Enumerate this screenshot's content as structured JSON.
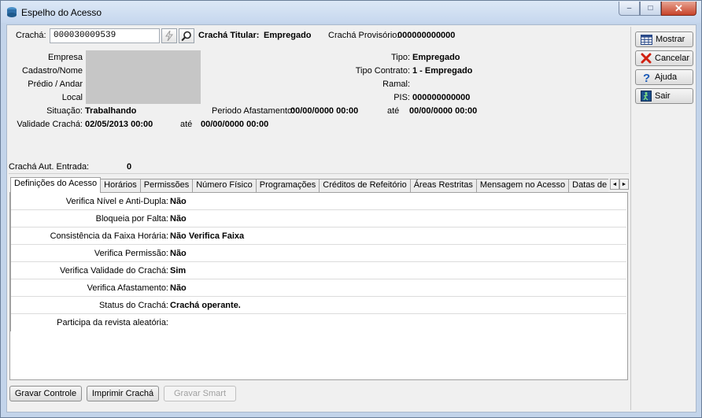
{
  "window": {
    "title": "Espelho do Acesso",
    "controls": {
      "minimize": "‒",
      "maximize": "□",
      "close": "✕"
    }
  },
  "header": {
    "cracha_label": "Crachá:",
    "cracha_value": "000030009539",
    "titular_label": "Crachá Titular:",
    "titular_value": "Empregado",
    "provisorio_label": "Crachá Provisório:",
    "provisorio_value": "000000000000"
  },
  "info_left": {
    "empresa_label": "Empresa",
    "cadastro_label": "Cadastro/Nome",
    "predio_label": "Prédio / Andar",
    "local_label": "Local",
    "situacao_label": "Situação:",
    "situacao_value": "Trabalhando",
    "validade_label": "Validade Crachá:",
    "validade_value": "02/05/2013 00:00",
    "ate_label": "até",
    "validade_ate_value": "00/00/0000 00:00",
    "aut_entrada_label": "Crachá Aut. Entrada:",
    "aut_entrada_value": "0"
  },
  "info_right": {
    "tipo_label": "Tipo:",
    "tipo_value": "Empregado",
    "tipo_contrato_label": "Tipo Contrato:",
    "tipo_contrato_value": "1 - Empregado",
    "ramal_label": "Ramal:",
    "pis_label": "PIS:",
    "pis_value": "000000000000",
    "periodo_label": "Periodo Afastamento:",
    "periodo_value": "00/00/0000 00:00",
    "periodo_ate_label": "até",
    "periodo_ate_value": "00/00/0000 00:00"
  },
  "tabs": [
    {
      "label": "Definições do Acesso",
      "active": true
    },
    {
      "label": "Horários"
    },
    {
      "label": "Permissões"
    },
    {
      "label": "Número Físico"
    },
    {
      "label": "Programações"
    },
    {
      "label": "Créditos de Refeitório"
    },
    {
      "label": "Áreas Restritas"
    },
    {
      "label": "Mensagem no Acesso"
    },
    {
      "label": "Datas de Validade"
    }
  ],
  "tab_arrows": {
    "left": "◄",
    "right": "►"
  },
  "definicoes": [
    {
      "label": "Verifica Nível e Anti-Dupla:",
      "value": "Não"
    },
    {
      "label": "Bloqueia por Falta:",
      "value": "Não"
    },
    {
      "label": "Consistência da Faixa Horária:",
      "value": "Não Verifica Faixa"
    },
    {
      "label": "Verifica Permissão:",
      "value": "Não"
    },
    {
      "label": "Verifica Validade do Crachá:",
      "value": "Sim"
    },
    {
      "label": "Verifica Afastamento:",
      "value": "Não"
    },
    {
      "label": "Status do Crachá:",
      "value": "Crachá operante."
    },
    {
      "label": "Participa da revista aleatória:",
      "value": ""
    }
  ],
  "bottom_buttons": {
    "gravar_controle": "Gravar Controle",
    "imprimir_cracha": "Imprimir Crachá",
    "gravar_smart": "Gravar Smart"
  },
  "side_buttons": {
    "mostrar": "Mostrar",
    "cancelar": "Cancelar",
    "ajuda": "Ajuda",
    "sair": "Sair"
  }
}
